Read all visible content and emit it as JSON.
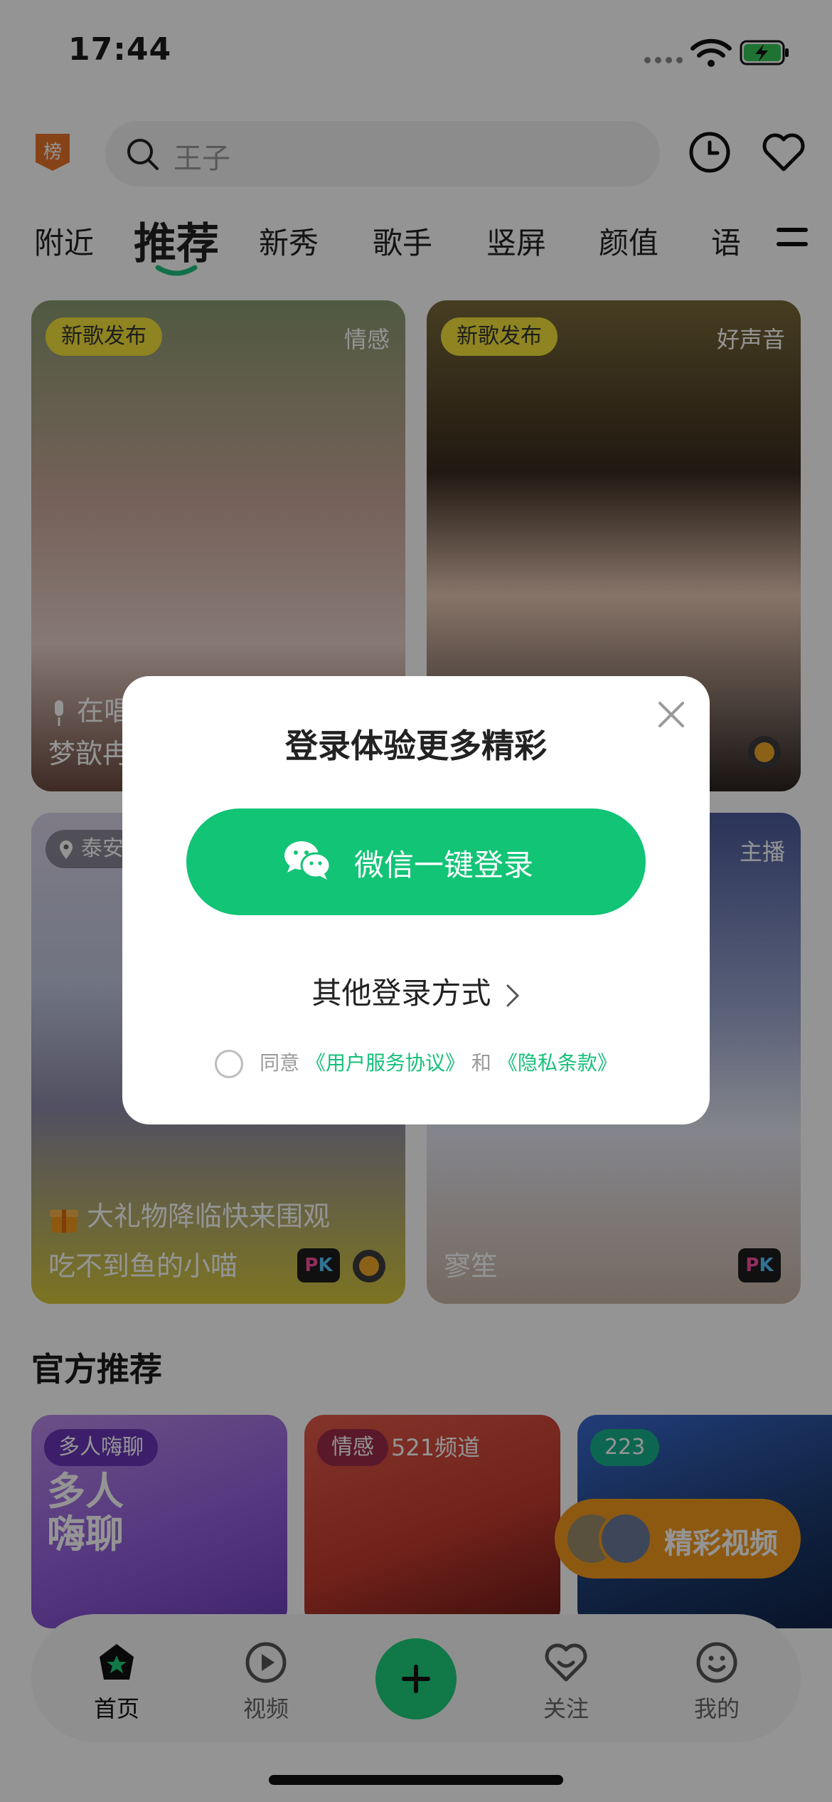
{
  "status_bar": {
    "time": "17:44"
  },
  "topbar": {
    "rank_label": "榜",
    "search_placeholder": "王子"
  },
  "tabs": [
    {
      "label": "附近"
    },
    {
      "label": "推荐",
      "active": true
    },
    {
      "label": "新秀"
    },
    {
      "label": "歌手"
    },
    {
      "label": "竖屏"
    },
    {
      "label": "颜值"
    },
    {
      "label": "语"
    }
  ],
  "cards": [
    {
      "badge": "新歌发布",
      "tag": "情感",
      "line1": "在唱",
      "line2": "梦歆冉"
    },
    {
      "badge": "新歌发布",
      "tag": "好声音"
    },
    {
      "location": "泰安",
      "tag": "主播",
      "line1": "大礼物降临快来围观",
      "line2": "吃不到鱼的小喵",
      "pk": "PK"
    },
    {
      "line2": "寥笙",
      "pk": "PK"
    }
  ],
  "official": {
    "title": "官方推荐",
    "items": [
      {
        "badge": "多人嗨聊",
        "big_text": "多人嗨聊",
        "color": "#8e5bd9"
      },
      {
        "badge": "情感",
        "sub": "521频道",
        "color": "#d6433a"
      },
      {
        "badge": "223",
        "color": "#1c3b6e"
      }
    ]
  },
  "float_video": {
    "label": "精彩视频"
  },
  "bottom_nav": [
    {
      "label": "首页",
      "icon": "home-icon",
      "active": true
    },
    {
      "label": "视频",
      "icon": "video-icon"
    },
    {
      "label": "",
      "icon": "plus-icon"
    },
    {
      "label": "关注",
      "icon": "follow-icon"
    },
    {
      "label": "我的",
      "icon": "profile-icon"
    }
  ],
  "dialog": {
    "title": "登录体验更多精彩",
    "wechat_button": "微信一键登录",
    "other_login": "其他登录方式",
    "agree_prefix": "同意",
    "agree_link1": "《用户服务协议》",
    "agree_and": "和",
    "agree_link2": "《隐私条款》"
  },
  "colors": {
    "accent_green": "#12c476",
    "badge_yellow": "#f5e33a",
    "video_orange": "#f39a1e"
  }
}
